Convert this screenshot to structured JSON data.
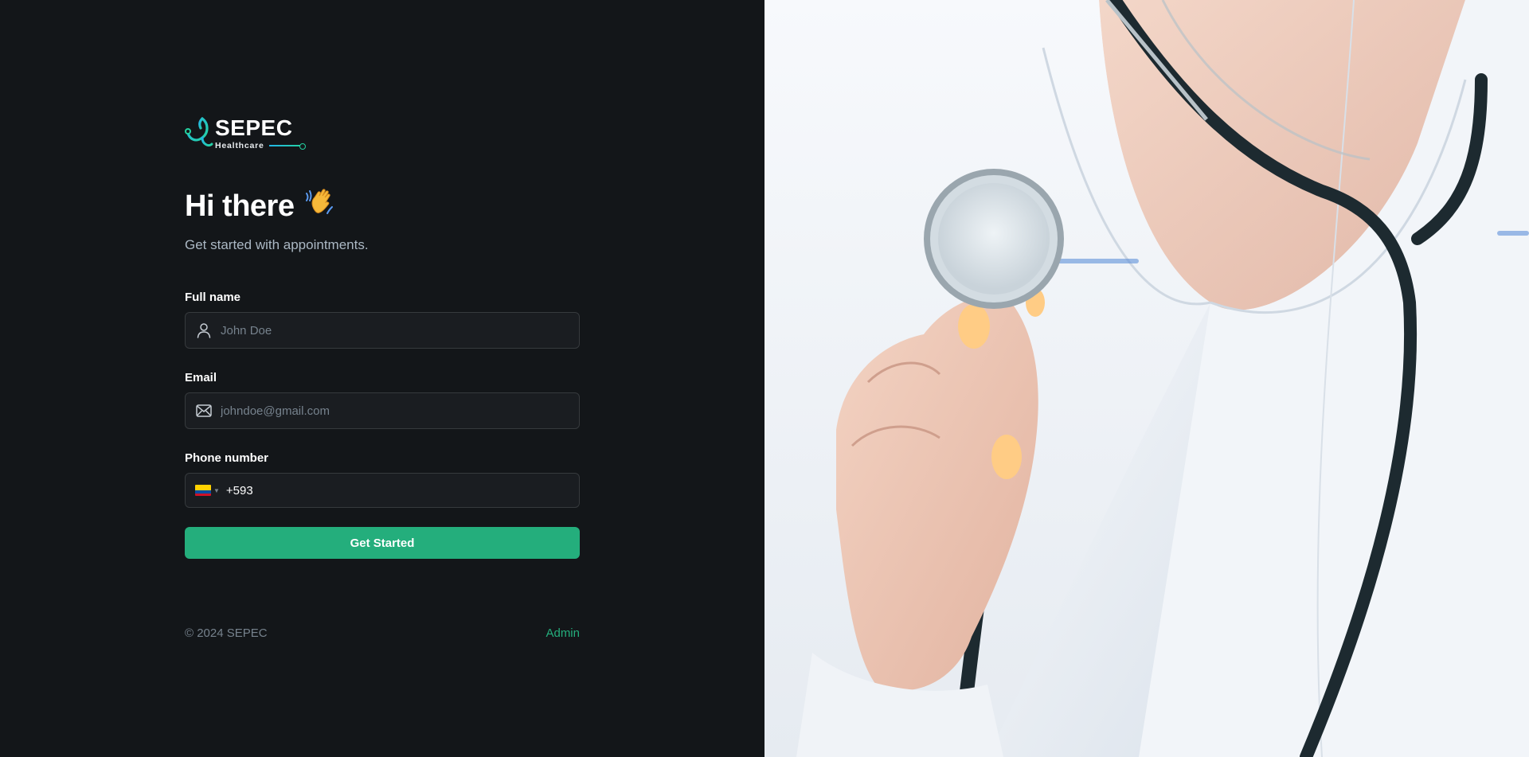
{
  "brand": {
    "name": "SEPEC",
    "tagline": "Healthcare",
    "accent": "#24ae7c",
    "logo_icon": "stethoscope-icon"
  },
  "hero": {
    "greeting": "Hi there",
    "greeting_emoji": "👋",
    "subtitle": "Get started with appointments."
  },
  "form": {
    "full_name": {
      "label": "Full name",
      "placeholder": "John Doe",
      "icon": "user-icon"
    },
    "email": {
      "label": "Email",
      "placeholder": "johndoe@gmail.com",
      "icon": "mail-icon"
    },
    "phone": {
      "label": "Phone number",
      "country_flag": "Ecuador",
      "value": "+593"
    },
    "submit_label": "Get Started"
  },
  "footer": {
    "copyright": "© 2024 SEPEC",
    "admin_link": "Admin"
  },
  "colors": {
    "background": "#131619",
    "input_bg": "#1a1d21",
    "input_border": "#363a3d",
    "muted_text": "#76828d",
    "button": "#24ae7c"
  }
}
